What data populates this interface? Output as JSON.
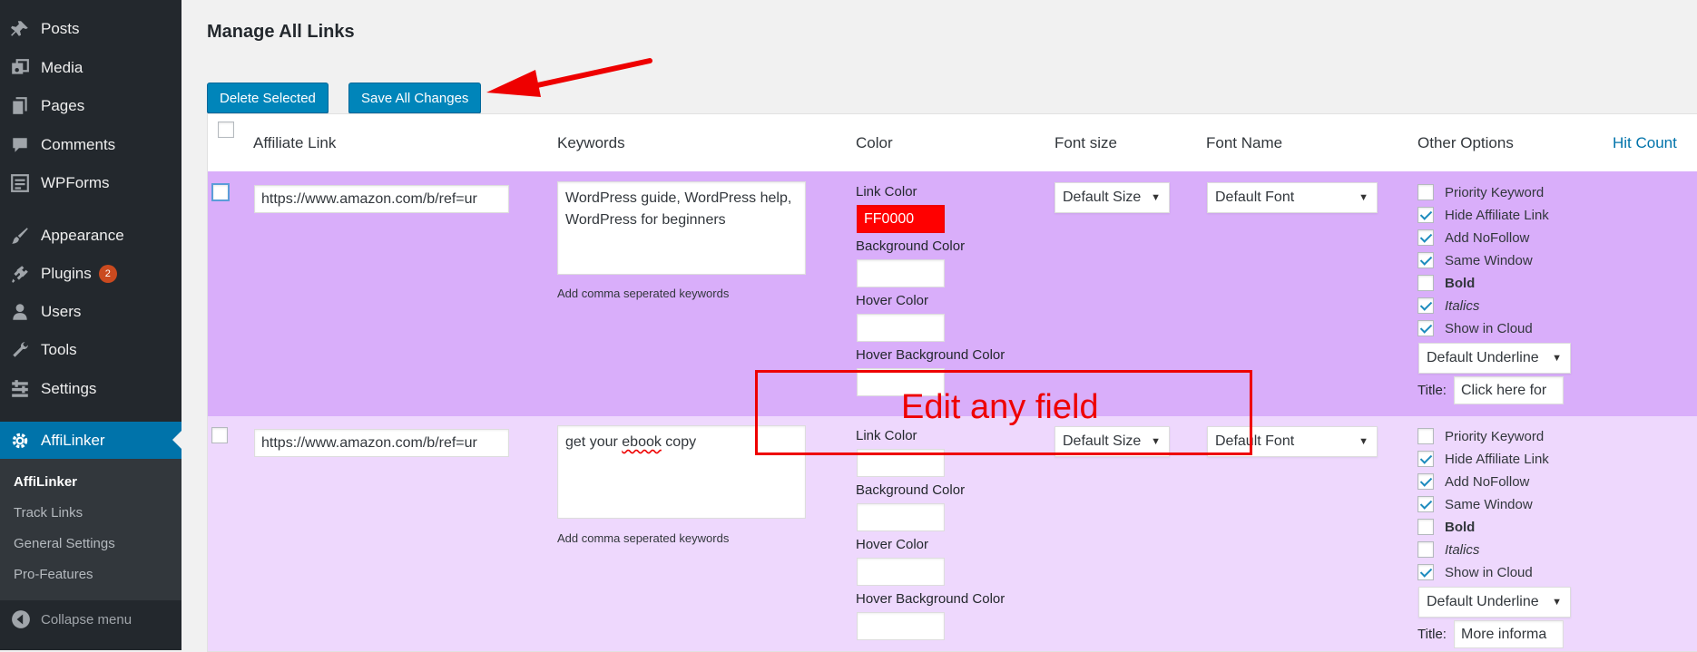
{
  "sidebar": {
    "items": [
      {
        "label": "Posts",
        "icon": "pin-icon"
      },
      {
        "label": "Media",
        "icon": "media-icon"
      },
      {
        "label": "Pages",
        "icon": "pages-icon"
      },
      {
        "label": "Comments",
        "icon": "comments-icon"
      },
      {
        "label": "WPForms",
        "icon": "wpforms-icon"
      },
      {
        "label": "Appearance",
        "icon": "paintbrush-icon"
      },
      {
        "label": "Plugins",
        "icon": "plugin-icon",
        "badge": "2"
      },
      {
        "label": "Users",
        "icon": "users-icon"
      },
      {
        "label": "Tools",
        "icon": "wrench-icon"
      },
      {
        "label": "Settings",
        "icon": "settings-icon"
      },
      {
        "label": "AffiLinker",
        "icon": "gear-icon"
      }
    ],
    "submenu": [
      "AffiLinker",
      "Track Links",
      "General Settings",
      "Pro-Features"
    ],
    "collapse_label": "Collapse menu"
  },
  "page": {
    "title": "Manage All Links",
    "delete_button": "Delete Selected",
    "save_button": "Save All Changes"
  },
  "table": {
    "headers": {
      "affiliate_link": "Affiliate Link",
      "keywords": "Keywords",
      "color": "Color",
      "font_size": "Font size",
      "font_name": "Font Name",
      "other_options": "Other Options",
      "hit_count": "Hit Count"
    },
    "labels": {
      "keywords_hint": "Add comma seperated keywords",
      "link_color": "Link Color",
      "background_color": "Background Color",
      "hover_color": "Hover Color",
      "hover_background_color": "Hover Background Color",
      "title": "Title:"
    },
    "option_labels": [
      "Priority Keyword",
      "Hide Affiliate Link",
      "Add NoFollow",
      "Same Window",
      "Bold",
      "Italics",
      "Show in Cloud"
    ],
    "rows": [
      {
        "url": "https://www.amazon.com/b/ref=ur",
        "keywords": "WordPress guide, WordPress help, WordPress for beginners",
        "link_color": "FF0000",
        "link_color_hex": "#ff0000",
        "font_size": "Default Size",
        "font_name": "Default Font",
        "underline": "Default Underline",
        "title_value": "Click here for",
        "options_checked": [
          false,
          true,
          true,
          true,
          false,
          true,
          true
        ],
        "row_bg": "#d9aefa"
      },
      {
        "url": "https://www.amazon.com/b/ref=ur",
        "keywords_pre": "get your ",
        "keywords_misspelled": "ebook",
        "keywords_post": " copy",
        "link_color": "",
        "font_size": "Default Size",
        "font_name": "Default Font",
        "underline": "Default Underline",
        "title_value": "More informa",
        "options_checked": [
          false,
          true,
          true,
          true,
          false,
          false,
          true
        ],
        "row_bg": "#eed8fd"
      }
    ]
  },
  "annotation": {
    "text": "Edit any field",
    "color": "#ee0000"
  },
  "colors": {
    "sidebar_bg": "#23282d",
    "accent": "#0073aa",
    "button": "#0085ba"
  }
}
